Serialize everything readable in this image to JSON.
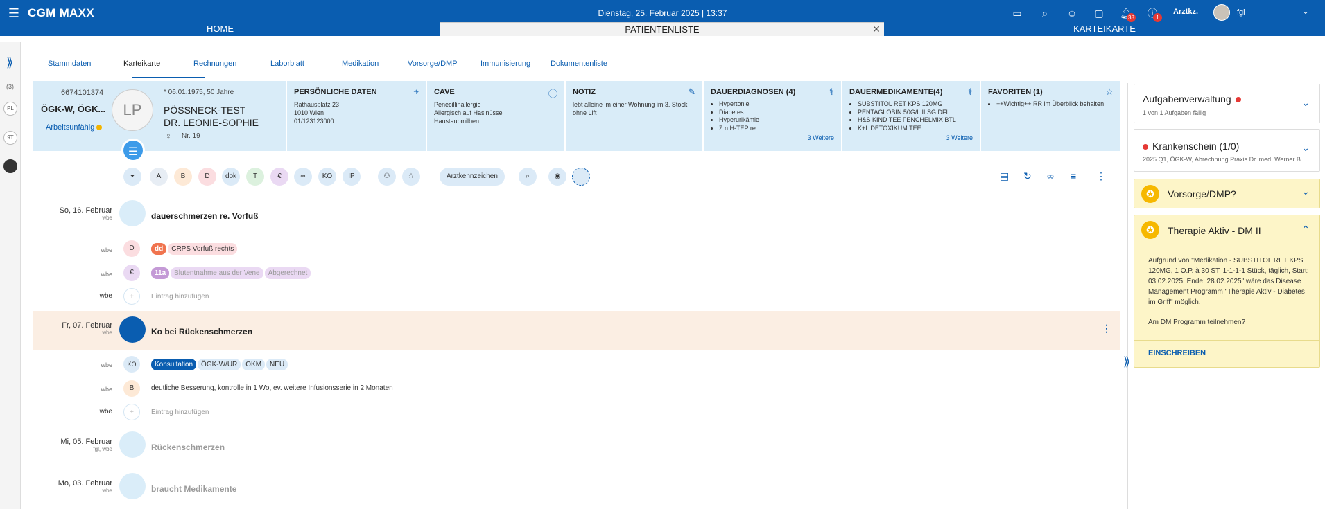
{
  "app": {
    "title": "CGM MAXX",
    "datetime": "Dienstag, 25. Februar 2025 | 13:37",
    "arztkz": "Arztkz.",
    "user": "fgl",
    "notif_count": "38",
    "info_count": "1"
  },
  "nav": {
    "home": "HOME",
    "patientenliste": "PATIENTENLISTE",
    "karteikarte": "KARTEIKARTE"
  },
  "rail": {
    "count": "(3)",
    "pl": "PL",
    "st": "9T"
  },
  "subtabs": [
    "Stammdaten",
    "Karteikarte",
    "Rechnungen",
    "Laborblatt",
    "Medikation",
    "Vorsorge/DMP",
    "Immunisierung",
    "Dokumentenliste"
  ],
  "patient": {
    "id": "6674101374",
    "kasse": "ÖGK-W, ÖGK...",
    "status": "Arbeitsunfähig",
    "initials": "LP",
    "dob": "* 06.01.1975, 50 Jahre",
    "name1": "PÖSSNECK-TEST",
    "name2": "DR. LEONIE-SOPHIE",
    "sex": "♀",
    "nr": "Nr. 19"
  },
  "persoenlich": {
    "title": "PERSÖNLICHE DATEN",
    "l1": "Rathausplatz 23",
    "l2": "1010 Wien",
    "l3": "01/123123000"
  },
  "cave": {
    "title": "CAVE",
    "l1": "Penecillinallergie",
    "l2": "Allergisch auf Haslnüsse",
    "l3": "Haustaubmilben"
  },
  "notiz": {
    "title": "NOTIZ",
    "l1": "lebt alleine im einer Wohnung im 3. Stock",
    "l2": "ohne Lift"
  },
  "dauerdiagnosen": {
    "title": "DAUERDIAGNOSEN (4)",
    "items": [
      "Hypertonie",
      "Diabetes",
      "Hyperurikämie",
      "Z.n.H-TEP re"
    ],
    "more": "3 Weitere"
  },
  "dauermedikamente": {
    "title": "DAUERMEDIKAMENTE(4)",
    "items": [
      "SUBSTITOL RET KPS 120MG",
      "PENTAGLOBIN 50G/L ILSG DFL",
      "H&S KIND TEE FENCHELMIX BTL",
      "K+L DETOXIKUM TEE"
    ],
    "more": "3 Weitere"
  },
  "favoriten": {
    "title": "FAVORITEN (1)",
    "items": [
      "++Wichtig++ RR im Überblick behalten"
    ]
  },
  "filters": {
    "a": "A",
    "b": "B",
    "d": "D",
    "dok": "dok",
    "t": "T",
    "euro": "€",
    "ko": "KO",
    "ip": "IP",
    "arztkennzeichen": "Arztkennzeichen"
  },
  "entries": {
    "e1": {
      "date": "So, 16. Februar",
      "user": "wbe",
      "title": "dauerschmerzen re. Vorfuß",
      "d": {
        "user": "wbe",
        "letter": "D",
        "code": "dd",
        "text": "CRPS Vorfuß rechts"
      },
      "f": {
        "user": "wbe",
        "letter": "€",
        "code": "11a",
        "text": "Blutentnahme aus der Vene",
        "status": "Abgerechnet"
      },
      "add": {
        "user": "wbe",
        "text": "Eintrag hinzufügen"
      }
    },
    "e2": {
      "date": "Fr, 07. Februar",
      "user": "wbe",
      "title": "Ko bei Rückenschmerzen",
      "ko": {
        "user": "wbe",
        "letter": "KO",
        "tags": [
          "Konsultation",
          "ÖGK-W/UR",
          "OKM",
          "NEU"
        ]
      },
      "b": {
        "user": "wbe",
        "letter": "B",
        "text": "deutliche Besserung, kontrolle in 1 Wo, ev. weitere Infusionsserie in 2 Monaten"
      },
      "add": {
        "user": "wbe",
        "text": "Eintrag hinzufügen"
      }
    },
    "e3": {
      "date": "Mi, 05. Februar",
      "user": "fgl, wbe",
      "title": "Rückenschmerzen"
    },
    "e4": {
      "date": "Mo, 03. Februar",
      "user": "wbe",
      "title": "braucht Medikamente"
    }
  },
  "side": {
    "aufgaben": {
      "title": "Aufgabenverwaltung",
      "sub": "1 von 1 Aufgaben fällig"
    },
    "kschein": {
      "title": "Krankenschein (1/0)",
      "sub": "2025 Q1, ÖGK-W, Abrechnung Praxis Dr. med. Werner B..."
    },
    "vorsorge": {
      "title": "Vorsorge/DMP?"
    },
    "therapie": {
      "title": "Therapie Aktiv - DM II",
      "body": "Aufgrund von \"Medikation - SUBSTITOL RET KPS 120MG, 1 O.P. à 30 ST, 1-1-1-1 Stück, täglich, Start: 03.02.2025, Ende: 28.02.2025\" wäre das Disease Management Programm \"Therapie Aktiv - Diabetes im Griff\" möglich.",
      "question": "Am DM Programm teilnehmen?",
      "button": "EINSCHREIBEN"
    }
  },
  "colors": {
    "primary": "#0a5db0",
    "header_bg": "#d9ecf8",
    "highlight": "#fbeee3",
    "alert": "#e53935",
    "dmp_yellow": "#fdf5c8"
  }
}
